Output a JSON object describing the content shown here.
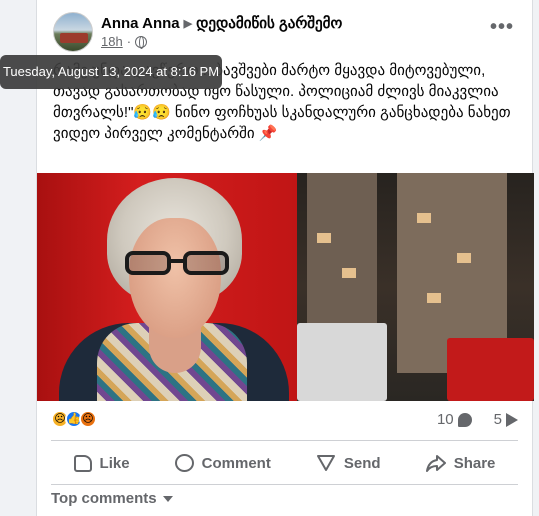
{
  "post": {
    "author": "Anna Anna",
    "group": "დედამიწის გარშემო",
    "time": "18h",
    "more": "•••",
    "tooltip": "Tuesday, August 13, 2024 at 8:16 PM",
    "text": "რამე უნდა დავწერო... ბავშვები მარტო მყავდა მიტოვებული, თავად გასართობად იყო წასული. პოლიციამ ძლივს მიაკვლია მთვრალს!\"😥😥 ნინო ფოჩხუას სკანდალური განცხადება ნახეთ ვიდეო პირველ კომენტარში 📌"
  },
  "reactions": {
    "icons": [
      "sad-icon",
      "like-icon",
      "angry-icon"
    ],
    "comment_count": "10",
    "share_count": "5"
  },
  "actions": {
    "like": "Like",
    "comment": "Comment",
    "send": "Send",
    "share": "Share"
  },
  "comments": {
    "sort_label": "Top comments"
  },
  "colors": {
    "accent": "#1877f2",
    "muted": "#65676b",
    "background": "#f0f2f5"
  }
}
